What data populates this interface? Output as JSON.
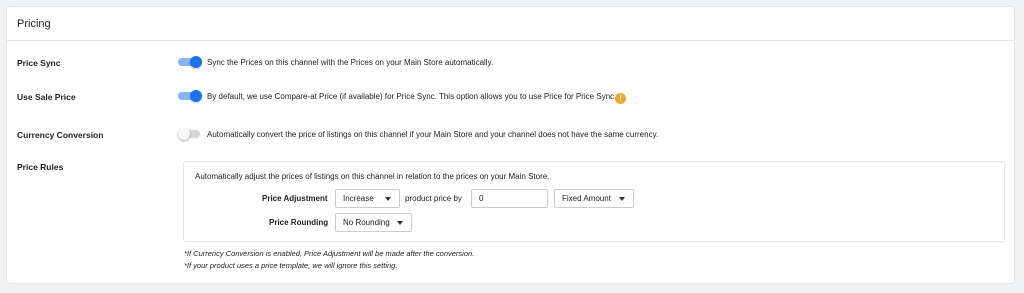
{
  "card": {
    "title": "Pricing"
  },
  "rows": {
    "price_sync": {
      "label": "Price Sync",
      "enabled": true,
      "description": "Sync the Prices on this channel with the Prices on your Main Store automatically."
    },
    "use_sale_price": {
      "label": "Use Sale Price",
      "enabled": true,
      "description": "By default, we use Compare-at Price (if available) for Price Sync. This option allows you to use Price for Price Sync",
      "info_icon": "!"
    },
    "currency_conversion": {
      "label": "Currency Conversion",
      "enabled": false,
      "description": "Automatically convert the price of listings on this channel if your Main Store and your channel does not have the same currency."
    },
    "price_rules": {
      "label": "Price Rules"
    }
  },
  "price_rules": {
    "description": "Automatically adjust the prices of listings on this channel in relation to the prices on your Main Store.",
    "adjustment": {
      "label": "Price Adjustment",
      "direction_value": "Increase",
      "connector_text": "product price by",
      "amount_value": "0",
      "amount_type_value": "Fixed Amount"
    },
    "rounding": {
      "label": "Price Rounding",
      "value": "No Rounding"
    }
  },
  "notes": [
    "*If Currency Conversion is enabled, Price Adjustment will be made after the conversion.",
    "*If your product uses a price template, we will ignore this setting."
  ],
  "colors": {
    "toggle_on": "#1a73e8",
    "toggle_on_track": "#8ab4f3",
    "info_icon": "#f0a52b"
  }
}
